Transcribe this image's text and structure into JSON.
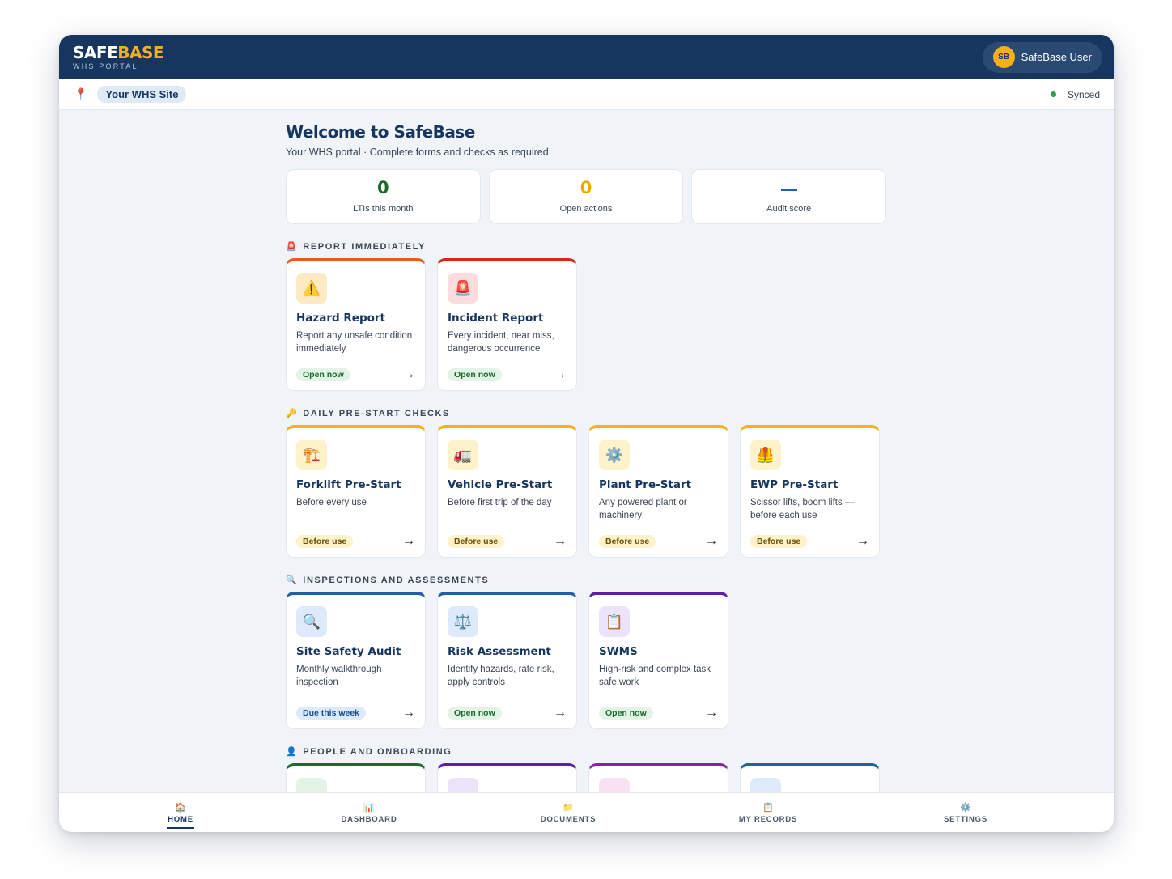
{
  "header": {
    "brand_safe": "SAFE",
    "brand_base": "BASE",
    "brand_sub": "WHS PORTAL",
    "user_initials": "SB",
    "user_name": "SafeBase User"
  },
  "sitebar": {
    "site_name": "Your WHS Site",
    "sync_status": "Synced"
  },
  "main": {
    "title": "Welcome to SafeBase",
    "subtitle": "Your WHS portal · Complete forms and checks as required"
  },
  "stats": [
    {
      "value": "0",
      "label": "LTIs this month",
      "color": "#1b6b2d"
    },
    {
      "value": "0",
      "label": "Open actions",
      "color": "#f0a800"
    },
    {
      "value": "",
      "label": "Audit score",
      "color": "#1f5fb4"
    }
  ],
  "sections": {
    "report": {
      "title": "REPORT IMMEDIATELY",
      "icon": "🚨"
    },
    "daily": {
      "title": "DAILY PRE-START CHECKS",
      "icon": "🔑"
    },
    "inspections": {
      "title": "INSPECTIONS AND ASSESSMENTS",
      "icon": "🔍"
    },
    "people": {
      "title": "PEOPLE AND ONBOARDING",
      "icon": "👤"
    }
  },
  "report_cards": [
    {
      "icon": "⚠️",
      "title": "Hazard Report",
      "desc": "Report any unsafe condition immediately",
      "badge": "Open now",
      "accent": "#f0571a",
      "icon_bg": "#fde9c2"
    },
    {
      "icon": "🚨",
      "title": "Incident Report",
      "desc": "Every incident, near miss, dangerous occurrence",
      "badge": "Open now",
      "accent": "#d8261c",
      "icon_bg": "#fcdcdc"
    }
  ],
  "daily_cards": [
    {
      "icon": "🏗️",
      "title": "Forklift Pre-Start",
      "desc": "Before every use",
      "badge": "Before use",
      "accent": "#f5b01c",
      "icon_bg": "#fdf2c9"
    },
    {
      "icon": "🚛",
      "title": "Vehicle Pre-Start",
      "desc": "Before first trip of the day",
      "badge": "Before use",
      "accent": "#f5b01c",
      "icon_bg": "#fdf2c9"
    },
    {
      "icon": "⚙️",
      "title": "Plant Pre-Start",
      "desc": "Any powered plant or machinery",
      "badge": "Before use",
      "accent": "#f5b01c",
      "icon_bg": "#fdf2c9"
    },
    {
      "icon": "🦺",
      "title": "EWP Pre-Start",
      "desc": "Scissor lifts, boom lifts — before each use",
      "badge": "Before use",
      "accent": "#f5b01c",
      "icon_bg": "#fdf2c9"
    }
  ],
  "inspection_cards": [
    {
      "icon": "🔍",
      "title": "Site Safety Audit",
      "desc": "Monthly walkthrough inspection",
      "badge": "Due this week",
      "accent": "#1f5fa8",
      "icon_bg": "#ddeafb"
    },
    {
      "icon": "⚖️",
      "title": "Risk Assessment",
      "desc": "Identify hazards, rate risk, apply controls",
      "badge": "Open now",
      "accent": "#1f5fa8",
      "icon_bg": "#ddeafb"
    },
    {
      "icon": "📋",
      "title": "SWMS",
      "desc": "High-risk and complex task safe work",
      "badge": "Open now",
      "accent": "#5b1fa8",
      "icon_bg": "#ece3fa"
    }
  ],
  "people_cards": [
    {
      "accent": "#1b6b2d",
      "icon_bg": "#e3f3e6"
    },
    {
      "accent": "#5b1fa8",
      "icon_bg": "#ece3fa"
    },
    {
      "accent": "#8b1fa8",
      "icon_bg": "#f8e1f3"
    },
    {
      "accent": "#1f5fa8",
      "icon_bg": "#ddeafb"
    }
  ],
  "nav": [
    {
      "icon": "🏠",
      "label": "HOME",
      "active": true
    },
    {
      "icon": "📊",
      "label": "DASHBOARD"
    },
    {
      "icon": "📁",
      "label": "DOCUMENTS"
    },
    {
      "icon": "📋",
      "label": "MY RECORDS"
    },
    {
      "icon": "⚙️",
      "label": "SETTINGS"
    }
  ]
}
